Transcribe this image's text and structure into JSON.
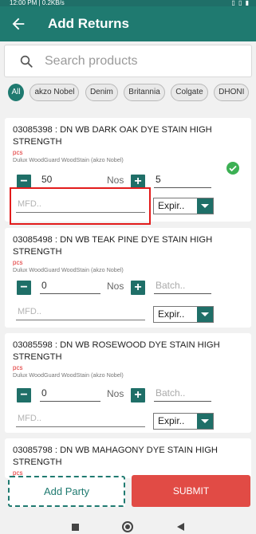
{
  "status_bar": {
    "time": "12:00 PM | 0.2KB/s",
    "icons": "▯ ▯ ▮"
  },
  "header": {
    "title": "Add Returns",
    "back_icon": "arrow-left-icon"
  },
  "search": {
    "placeholder": "Search products",
    "value": ""
  },
  "chips": [
    {
      "label": "All",
      "active": true
    },
    {
      "label": "akzo Nobel",
      "active": false
    },
    {
      "label": "Denim",
      "active": false
    },
    {
      "label": "Britannia",
      "active": false
    },
    {
      "label": "Colgate",
      "active": false
    },
    {
      "label": "DHONI",
      "active": false
    }
  ],
  "products": [
    {
      "title": "03085398 : DN WB DARK OAK DYE STAIN HIGH STRENGTH",
      "unit": "pcs",
      "brand": "Dulux WoodGuard WoodStain (akzo Nobel)",
      "quantity": "50",
      "unit_label": "Nos",
      "batch_placeholder": "Batch..",
      "batch_value": "5",
      "mfd_placeholder": "MFD..",
      "expiry_label": "Expir..",
      "checked": true
    },
    {
      "title": "03085498 : DN WB TEAK PINE DYE STAIN HIGH STRENGTH",
      "unit": "pcs",
      "brand": "Dulux WoodGuard WoodStain (akzo Nobel)",
      "quantity": "0",
      "unit_label": "Nos",
      "batch_placeholder": "Batch..",
      "batch_value": "",
      "mfd_placeholder": "MFD..",
      "expiry_label": "Expir..",
      "checked": false
    },
    {
      "title": "03085598 : DN WB ROSEWOOD DYE STAIN HIGH STRENGTH",
      "unit": "pcs",
      "brand": "Dulux WoodGuard WoodStain (akzo Nobel)",
      "quantity": "0",
      "unit_label": "Nos",
      "batch_placeholder": "Batch..",
      "batch_value": "",
      "mfd_placeholder": "MFD..",
      "expiry_label": "Expir..",
      "checked": false
    },
    {
      "title": "03085798 : DN WB MAHAGONY DYE STAIN HIGH STRENGTH",
      "unit": "pcs"
    }
  ],
  "footer": {
    "add_party": "Add Party",
    "submit": "SUBMIT"
  },
  "colors": {
    "primary": "#1f7a70",
    "accent_red": "#e14b45",
    "check_green": "#3cb054"
  }
}
